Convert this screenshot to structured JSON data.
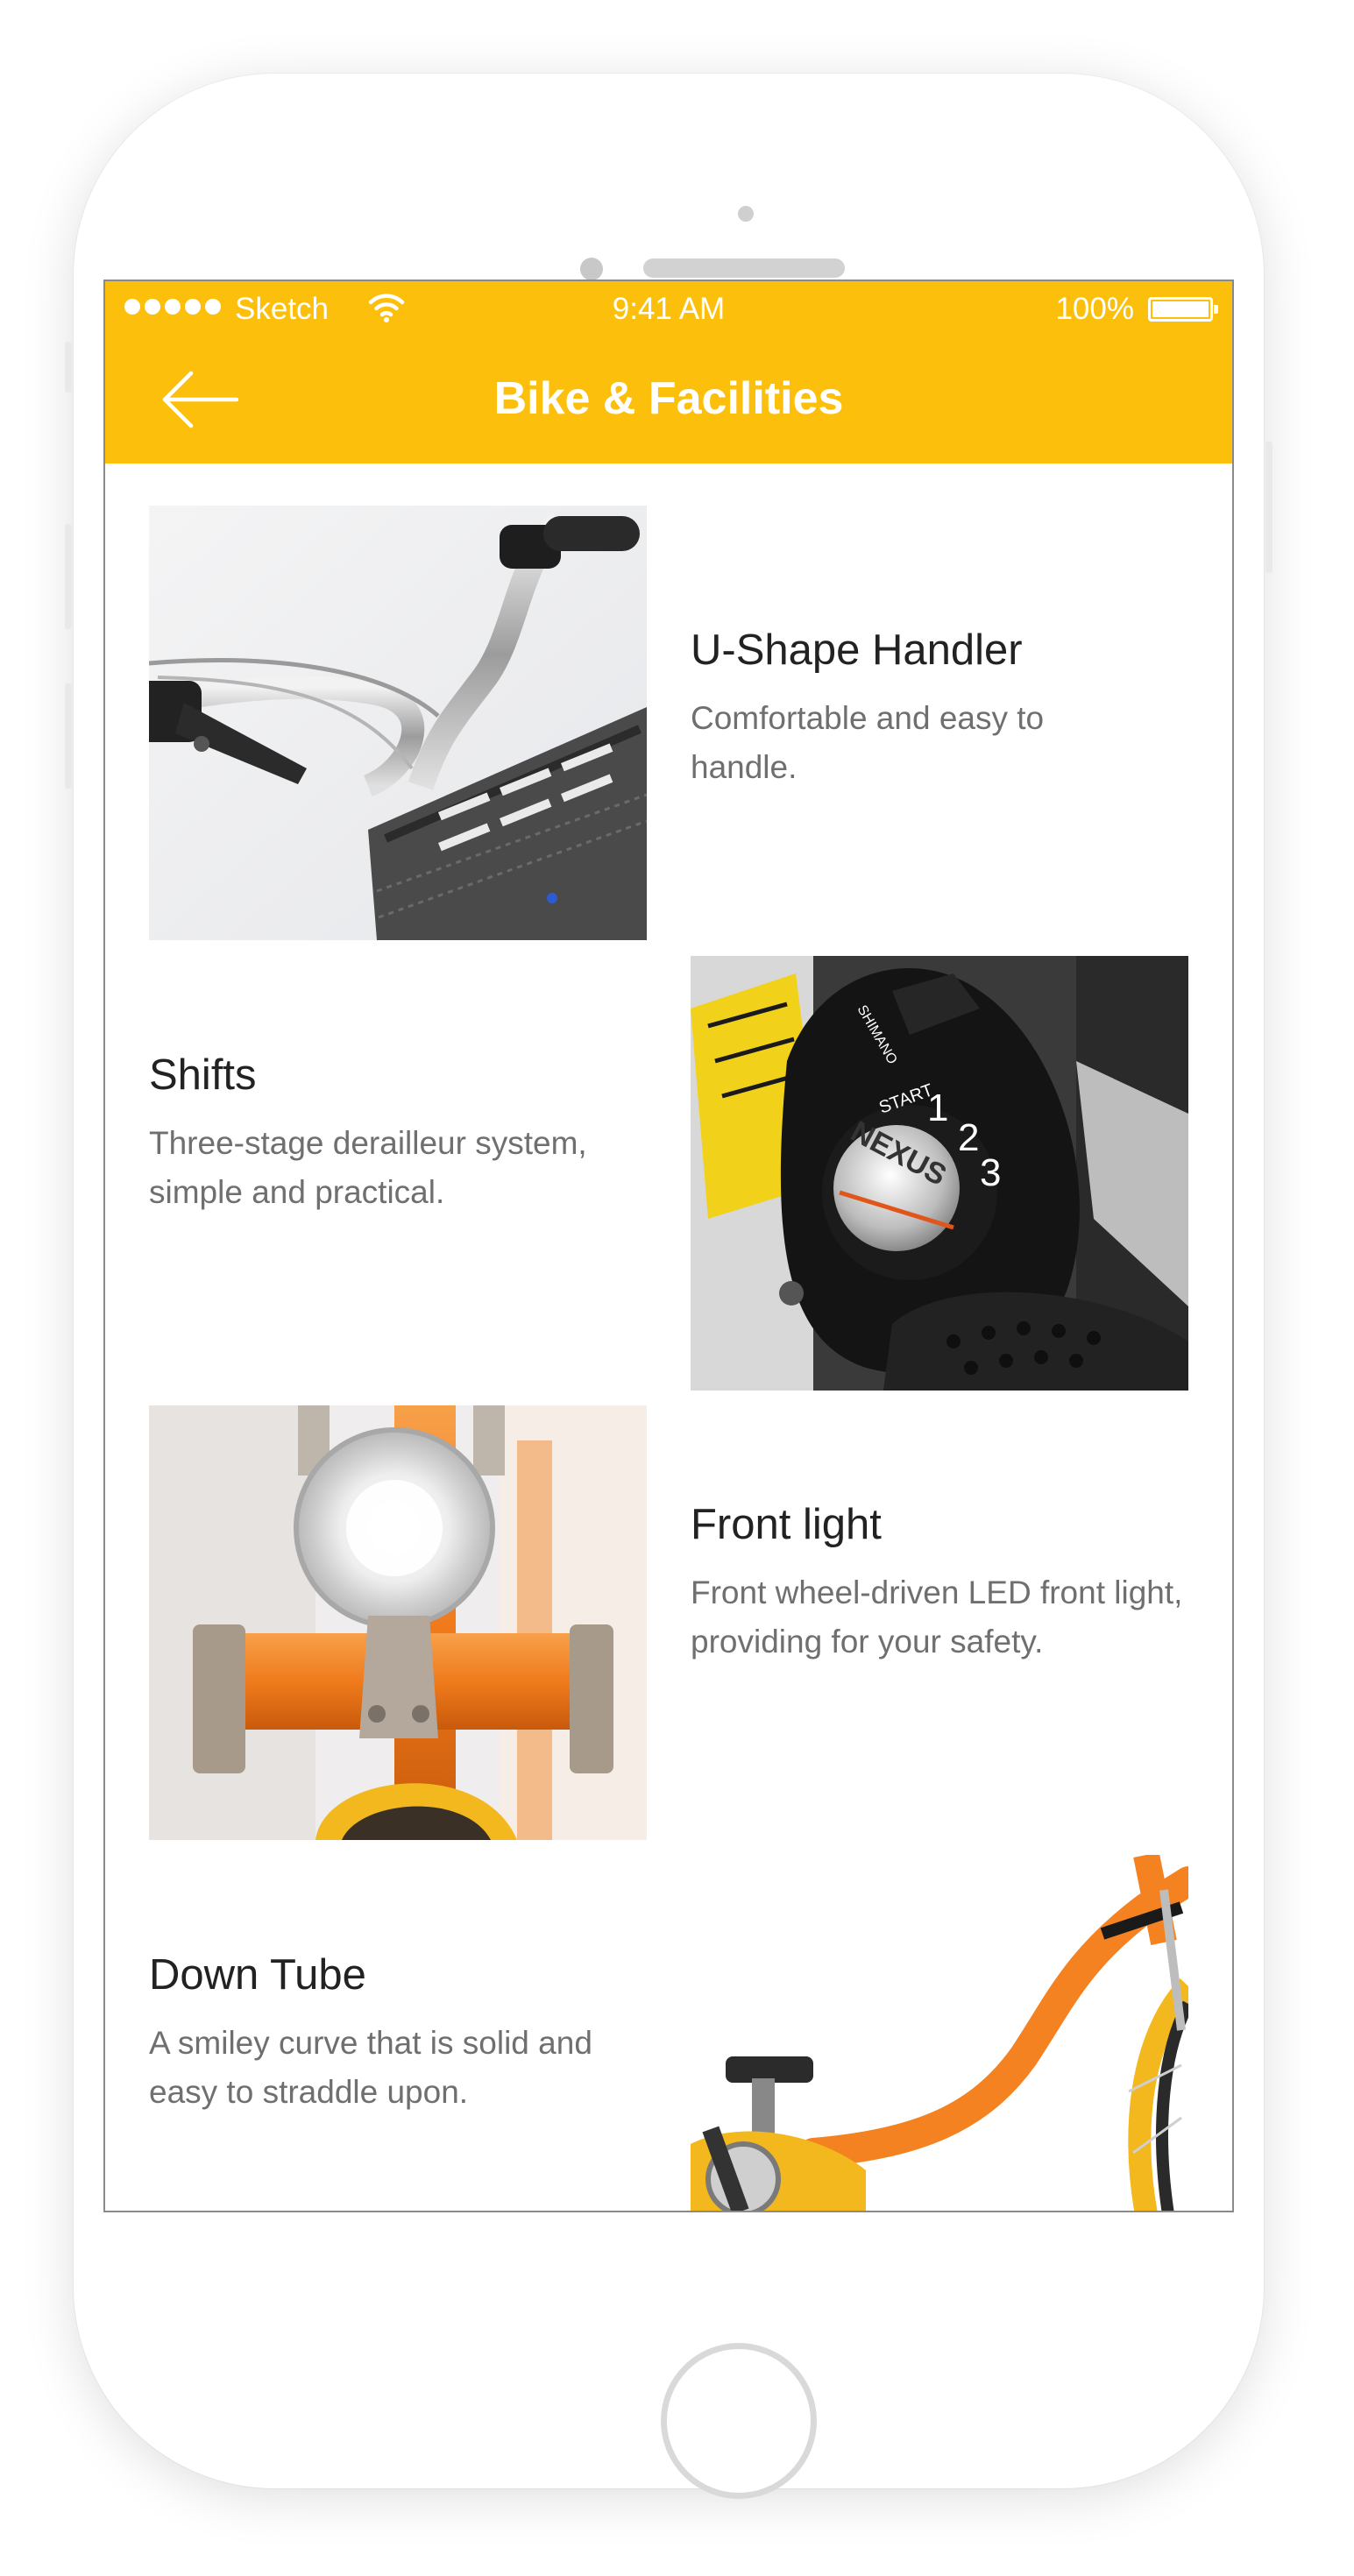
{
  "status_bar": {
    "carrier": "Sketch",
    "time": "9:41 AM",
    "battery": "100%"
  },
  "nav": {
    "title": "Bike & Facilities",
    "back_icon": "arrow-left-icon"
  },
  "features": [
    {
      "title": "U-Shape Handler",
      "desc": "Comfortable and easy to handle.",
      "image": "bike-handlebar-photo"
    },
    {
      "title": "Shifts",
      "desc": "Three-stage derailleur system, simple and practical.",
      "image": "gear-shifter-photo"
    },
    {
      "title": "Front light",
      "desc": "Front wheel-driven LED front light, providing for your safety.",
      "image": "front-light-photo"
    },
    {
      "title": "Down Tube",
      "desc": "A smiley curve that is solid and easy to straddle upon.",
      "image": "down-tube-photo"
    }
  ],
  "shifter_labels": {
    "brand": "NEXUS",
    "maker": "SHIMANO",
    "start": "START",
    "g1": "1",
    "g2": "2",
    "g3": "3"
  },
  "colors": {
    "accent": "#fcbf0b",
    "orange_frame": "#f58220",
    "title_text": "#222222",
    "desc_text": "#6f6f6f"
  }
}
